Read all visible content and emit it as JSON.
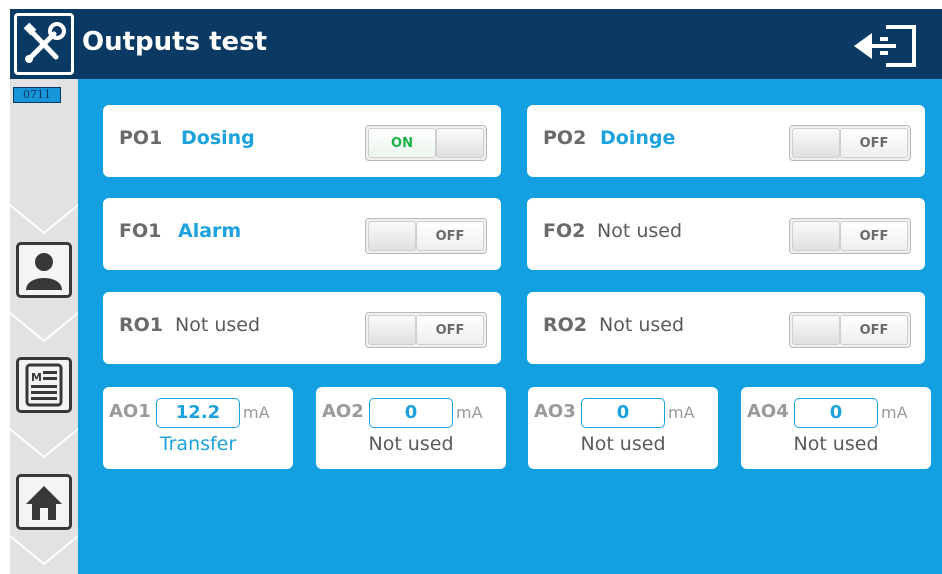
{
  "header": {
    "title": "Outputs test",
    "logo_icon": "tools-icon",
    "exit_icon": "exit-icon"
  },
  "sidebar": {
    "tag": "0711",
    "items": [
      {
        "icon": "user-icon"
      },
      {
        "icon": "menu-document-icon"
      },
      {
        "icon": "home-icon"
      }
    ]
  },
  "outputs": [
    {
      "code": "PO1",
      "name": "Dosing",
      "state": "ON",
      "active": true
    },
    {
      "code": "PO2",
      "name": "Doinge",
      "state": "OFF",
      "active": true
    },
    {
      "code": "FO1",
      "name": "Alarm",
      "state": "OFF",
      "active": true
    },
    {
      "code": "FO2",
      "name": "Not used",
      "state": "OFF",
      "active": false
    },
    {
      "code": "RO1",
      "name": "Not used",
      "state": "OFF",
      "active": false
    },
    {
      "code": "RO2",
      "name": "Not used",
      "state": "OFF",
      "active": false
    }
  ],
  "analog": [
    {
      "code": "AO1",
      "value": "12.2",
      "unit": "mA",
      "name": "Transfer",
      "active": true
    },
    {
      "code": "AO2",
      "value": "0",
      "unit": "mA",
      "name": "Not used",
      "active": false
    },
    {
      "code": "AO3",
      "value": "0",
      "unit": "mA",
      "name": "Not used",
      "active": false
    },
    {
      "code": "AO4",
      "value": "0",
      "unit": "mA",
      "name": "Not used",
      "active": false
    }
  ],
  "colors": {
    "header": "#0a3a63",
    "background": "#139fe0",
    "accent": "#1da2de",
    "on": "#1bb24a"
  }
}
